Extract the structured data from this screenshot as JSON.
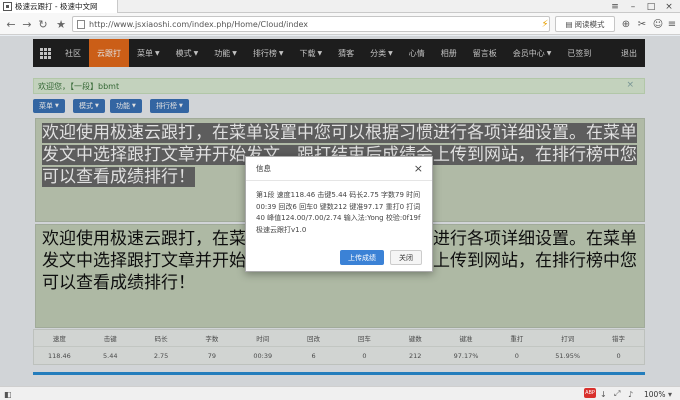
{
  "browser": {
    "tab_title": "极速云跟打 - 极速中文网",
    "url": "http://www.jsxiaoshi.com/index.php/Home/Cloud/index",
    "read_mode_label": "阅读模式",
    "zoom": "100%"
  },
  "nav": {
    "items": [
      {
        "label": "社区"
      },
      {
        "label": "云跟打",
        "active": true
      },
      {
        "label": "菜单",
        "caret": true
      },
      {
        "label": "模式",
        "caret": true
      },
      {
        "label": "功能",
        "caret": true
      },
      {
        "label": "排行榜",
        "caret": true
      },
      {
        "label": "下载",
        "caret": true
      },
      {
        "label": "猜客"
      },
      {
        "label": "分类",
        "caret": true
      },
      {
        "label": "心情"
      },
      {
        "label": "相册"
      },
      {
        "label": "留言板"
      },
      {
        "label": "会员中心",
        "caret": true
      },
      {
        "label": "已签到"
      }
    ],
    "logout": "退出"
  },
  "welcome": {
    "text": "欢迎您，【一段】bbmt",
    "close": "×"
  },
  "toolbar": [
    {
      "label": "菜单"
    },
    {
      "label": "模式"
    },
    {
      "label": "功能"
    },
    {
      "label": "排行榜"
    }
  ],
  "practice": {
    "text": "欢迎使用极速云跟打，在菜单设置中您可以根据习惯进行各项详细设置。在菜单发文中选择跟打文章并开始发文，跟打结束后成绩会上传到网站，在排行榜中您可以查看成绩排行！"
  },
  "stats": {
    "headers": [
      "速度",
      "击键",
      "码长",
      "字数",
      "时间",
      "回改",
      "回车",
      "键数",
      "键准",
      "重打",
      "打词",
      "错字"
    ],
    "values": [
      "118.46",
      "5.44",
      "2.75",
      "79",
      "00:39",
      "6",
      "0",
      "212",
      "97.17%",
      "0",
      "51.95%",
      "0"
    ]
  },
  "dialog": {
    "title": "信息",
    "body": "第1段 速度118.46 击键5.44 码长2.75 字数79 时间00:39 回改6 回车0 键数212 键准97.17 重打0 打词40 峰值124.00/7.00/2.74 输入法:Yong 校验:0f19f 极速云跟打v1.0",
    "upload_label": "上传成绩",
    "close_label": "关闭"
  }
}
